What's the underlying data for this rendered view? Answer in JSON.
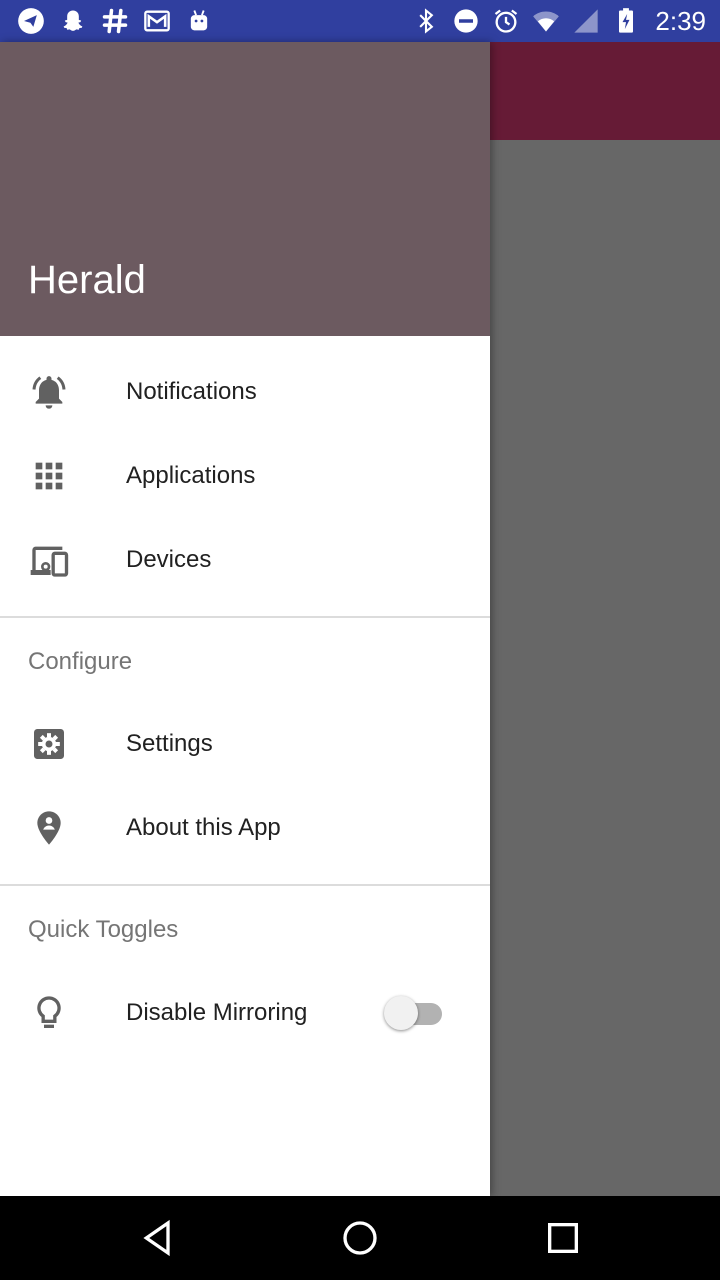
{
  "status_bar": {
    "time": "2:39",
    "left_icons": [
      "telegram-icon",
      "snapchat-icon",
      "slack-icon",
      "gmail-icon",
      "android-icon"
    ],
    "right_icons": [
      "bluetooth-icon",
      "do-not-disturb-icon",
      "alarm-icon",
      "wifi-icon",
      "battery-charging-icon"
    ],
    "background": "#303F9F"
  },
  "app": {
    "toolbar_color": "#661B36",
    "scrim_color": "#676767"
  },
  "drawer": {
    "header_color": "#6C5A60",
    "title": "Herald",
    "main_items": [
      {
        "label": "Notifications",
        "icon": "bell-ring-icon"
      },
      {
        "label": "Applications",
        "icon": "apps-grid-icon"
      },
      {
        "label": "Devices",
        "icon": "devices-icon"
      }
    ],
    "configure": {
      "header": "Configure",
      "items": [
        {
          "label": "Settings",
          "icon": "settings-icon"
        },
        {
          "label": "About this App",
          "icon": "location-person-icon"
        }
      ]
    },
    "quick_toggles": {
      "header": "Quick Toggles",
      "items": [
        {
          "label": "Disable Mirroring",
          "icon": "lightbulb-icon",
          "enabled": false
        }
      ]
    }
  },
  "nav_bar": {
    "buttons": [
      "back-icon",
      "home-icon",
      "recents-icon"
    ]
  }
}
